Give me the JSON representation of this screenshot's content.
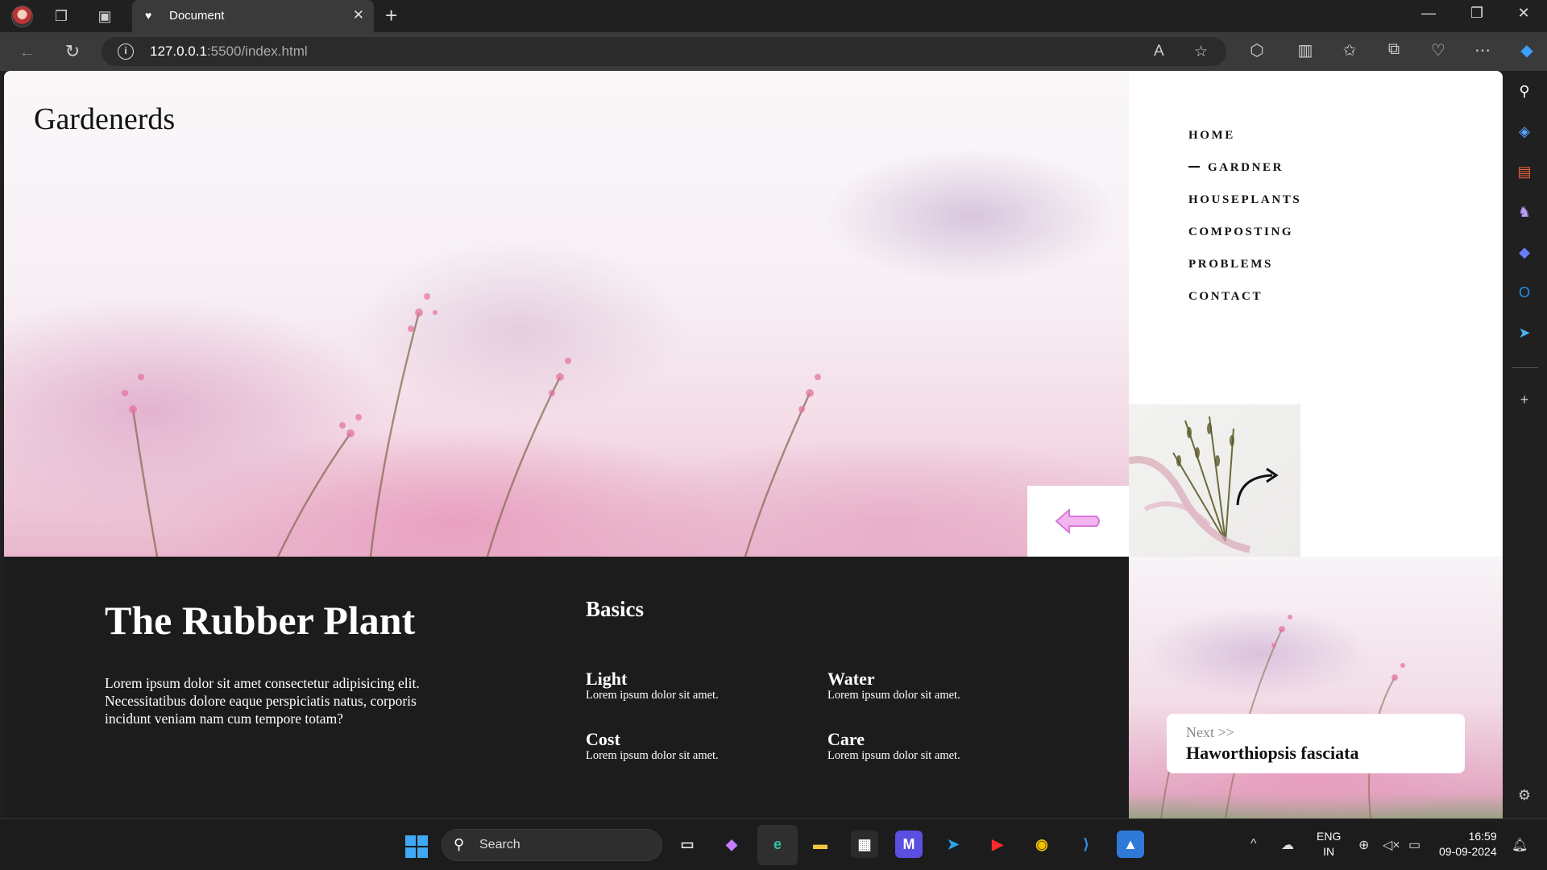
{
  "browser": {
    "tab_title": "Document",
    "url_host": "127.0.0.1",
    "url_path": ":5500/index.html"
  },
  "page": {
    "logo": "Gardenerds",
    "nav": [
      "HOME",
      "GARDNER",
      "HOUSEPLANTS",
      "COMPOSTING",
      "PROBLEMS",
      "CONTACT"
    ],
    "active_nav": "GARDNER",
    "title": "The Rubber Plant",
    "description": "Lorem ipsum dolor sit amet consectetur adipisicing elit. Necessitatibus dolore eaque perspiciatis natus, corporis incidunt veniam nam cum tempore totam?",
    "basics_heading": "Basics",
    "basics": [
      {
        "title": "Light",
        "text": "Lorem ipsum dolor sit amet."
      },
      {
        "title": "Water",
        "text": "Lorem ipsum dolor sit amet."
      },
      {
        "title": "Cost",
        "text": "Lorem ipsum dolor sit amet."
      },
      {
        "title": "Care",
        "text": "Lorem ipsum dolor sit amet."
      }
    ],
    "next_label": "Next >>",
    "next_name": "Haworthiopsis fasciata",
    "accent_color": "#e58ae3"
  },
  "taskbar": {
    "search_placeholder": "Search",
    "lang_line1": "ENG",
    "lang_line2": "IN",
    "time": "16:59",
    "date": "09-09-2024"
  }
}
